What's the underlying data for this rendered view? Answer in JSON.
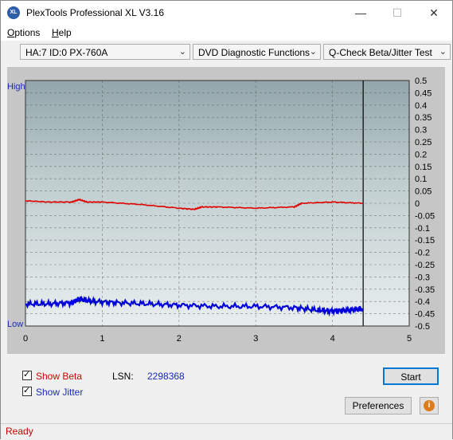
{
  "window": {
    "title": "PlexTools Professional XL V3.16",
    "app_icon_text": "XL"
  },
  "menu": {
    "items": [
      {
        "label": "Options",
        "accel": "O",
        "rest": "ptions"
      },
      {
        "label": "Help",
        "accel": "H",
        "rest": "elp"
      }
    ]
  },
  "toolbar": {
    "drive_combo": "HA:7 ID:0  PX-760A",
    "function_combo": "DVD Diagnostic Functions",
    "test_combo": "Q-Check Beta/Jitter Test"
  },
  "chart_data": {
    "type": "line",
    "xlim": [
      0,
      5
    ],
    "x_ticks": [
      "0",
      "1",
      "2",
      "3",
      "4",
      "5"
    ],
    "ylim": [
      -0.5,
      0.5
    ],
    "y_ticks": [
      "0.5",
      "0.45",
      "0.4",
      "0.35",
      "0.3",
      "0.25",
      "0.2",
      "0.15",
      "0.1",
      "0.05",
      "0",
      "-0.05",
      "-0.1",
      "-0.15",
      "-0.2",
      "-0.25",
      "-0.3",
      "-0.35",
      "-0.4",
      "-0.45",
      "-0.5"
    ],
    "left_labels": {
      "high": "High",
      "low": "Low"
    },
    "marker_x": 4.4,
    "grid": true,
    "series": [
      {
        "name": "Beta",
        "color": "#e00000",
        "x": [
          0,
          0.3,
          0.6,
          0.7,
          0.8,
          1.0,
          1.5,
          2.0,
          2.2,
          2.3,
          2.5,
          3.0,
          3.5,
          3.6,
          4.0,
          4.4
        ],
        "y": [
          0.01,
          0.005,
          0.005,
          0.015,
          0.005,
          0.005,
          -0.005,
          -0.02,
          -0.025,
          -0.015,
          -0.015,
          -0.02,
          -0.015,
          0.0,
          0.005,
          0.0
        ]
      },
      {
        "name": "Jitter",
        "color": "#0000dd",
        "x": [
          0,
          0.3,
          0.6,
          0.7,
          0.9,
          1.2,
          1.6,
          2.0,
          2.5,
          3.0,
          3.5,
          3.8,
          4.0,
          4.2,
          4.4
        ],
        "y": [
          -0.41,
          -0.41,
          -0.405,
          -0.39,
          -0.4,
          -0.405,
          -0.41,
          -0.415,
          -0.42,
          -0.42,
          -0.425,
          -0.435,
          -0.44,
          -0.435,
          -0.43
        ]
      }
    ]
  },
  "controls": {
    "show_beta": "Show Beta",
    "show_beta_accel": "B",
    "show_jitter": "Show Jitter",
    "show_jitter_accel": "J",
    "lsn_label": "LSN:",
    "lsn_value": "2298368",
    "start_button": "Start",
    "preferences_button": "Preferences",
    "info_icon": "i"
  },
  "status": {
    "text": "Ready"
  }
}
